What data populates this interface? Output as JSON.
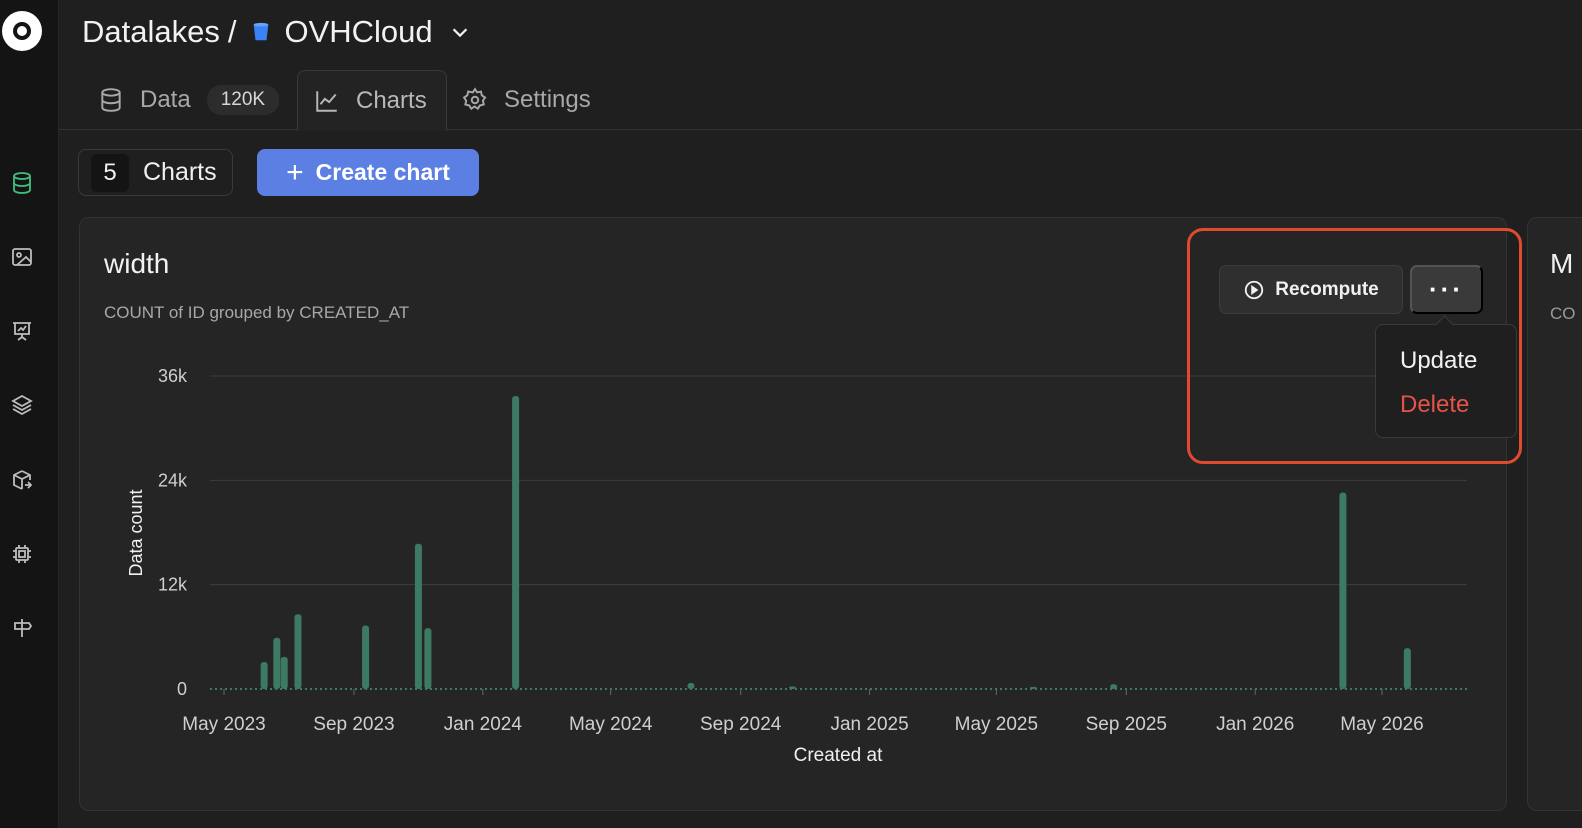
{
  "breadcrumb": {
    "root": "Datalakes",
    "separator": "/",
    "current": "OVHCloud"
  },
  "tabs": [
    {
      "label": "Data",
      "badge": "120K",
      "icon": "database-icon"
    },
    {
      "label": "Charts",
      "icon": "line-chart-icon",
      "active": true
    },
    {
      "label": "Settings",
      "icon": "gear-icon"
    }
  ],
  "toolbar": {
    "charts_count": "5",
    "charts_label": "Charts",
    "create_label": "Create chart"
  },
  "sidebar": {
    "items": [
      "database-icon",
      "image-icon",
      "presentation-chart-icon",
      "layers-icon",
      "box-export-icon",
      "chip-icon",
      "signpost-icon"
    ],
    "active_color": "#3fbf7f"
  },
  "card": {
    "title": "width",
    "subtitle": "COUNT of ID grouped by CREATED_AT",
    "recompute_label": "Recompute",
    "more_label": "···"
  },
  "menu": {
    "update_label": "Update",
    "delete_label": "Delete"
  },
  "next_card": {
    "title": "M",
    "subtitle": "CO"
  },
  "colors": {
    "accent": "#5b7fe3",
    "bar": "#3d7a64",
    "danger": "#e5534b",
    "highlight": "#e04a30"
  },
  "chart_data": {
    "type": "bar",
    "title": "",
    "xlabel": "Created at",
    "ylabel": "Data count",
    "yticks": [
      "0",
      "12k",
      "24k",
      "36k"
    ],
    "ylim": [
      0,
      36000
    ],
    "xticks": [
      "May 2023",
      "Sep 2023",
      "Jan 2024",
      "May 2024",
      "Sep 2024",
      "Jan 2025",
      "May 2025",
      "Sep 2025",
      "Jan 2026",
      "May 2026"
    ],
    "grid": true,
    "series": [
      {
        "points": [
          {
            "x": "2023-06-08",
            "y": 3100
          },
          {
            "x": "2023-06-20",
            "y": 5900
          },
          {
            "x": "2023-06-27",
            "y": 3700
          },
          {
            "x": "2023-07-10",
            "y": 8600
          },
          {
            "x": "2023-09-12",
            "y": 7300
          },
          {
            "x": "2023-11-01",
            "y": 16700
          },
          {
            "x": "2023-11-10",
            "y": 7000
          },
          {
            "x": "2024-02-01",
            "y": 33700
          },
          {
            "x": "2024-07-16",
            "y": 700
          },
          {
            "x": "2024-10-20",
            "y": 300
          },
          {
            "x": "2025-06-05",
            "y": 250
          },
          {
            "x": "2025-08-20",
            "y": 550
          },
          {
            "x": "2026-03-25",
            "y": 22600
          },
          {
            "x": "2026-05-25",
            "y": 4700
          }
        ]
      }
    ]
  }
}
